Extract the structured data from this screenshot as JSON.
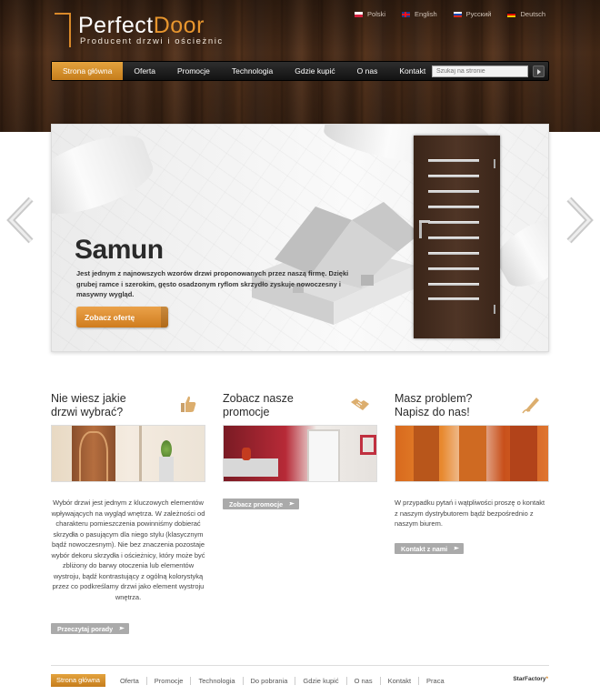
{
  "brand": {
    "name_part1": "Perfect",
    "name_part2": "Door",
    "tagline": "Producent drzwi i ościeżnic"
  },
  "languages": [
    {
      "label": "Polski",
      "flag": "pl-flag-icon"
    },
    {
      "label": "English",
      "flag": "uk-flag-icon"
    },
    {
      "label": "Русский",
      "flag": "ru-flag-icon"
    },
    {
      "label": "Deutsch",
      "flag": "de-flag-icon"
    }
  ],
  "nav": {
    "items": [
      "Strona główna",
      "Oferta",
      "Promocje",
      "Technologia",
      "Gdzie kupić",
      "O nas",
      "Kontakt"
    ],
    "active_index": 0,
    "search_placeholder": "Szukaj na stronie"
  },
  "slider": {
    "title": "Samun",
    "text": "Jest jednym z najnowszych wzorów drzwi proponowanych przez naszą firmę. Dzięki grubej ramce i szerokim, gęsto osadzonym ryflom skrzydło zyskuje nowoczesny i masywny wygląd.",
    "button": "Zobacz ofertę"
  },
  "features": [
    {
      "title_line1": "Nie wiesz jakie",
      "title_line2": "drzwi wybrać?",
      "icon": "thumbs-up-icon",
      "text": "Wybór drzwi jest jednym z kluczowych elementów wpływających na wygląd wnętrza. W zależności od charakteru pomieszczenia powinniśmy dobierać skrzydła o pasującym dla niego stylu (klasycznym bądź nowoczesnym). Nie bez znaczenia pozostaje wybór dekoru skrzydła i ościeżnicy, który może być zbliżony do barwy otoczenia lub elementów wystroju, bądź kontrastujący z ogólną kolorystyką przez co podkreślamy drzwi jako element wystroju wnętrza.",
      "button": "Przeczytaj porady"
    },
    {
      "title_line1": "Zobacz nasze",
      "title_line2": "promocje",
      "icon": "handshake-icon",
      "text": "",
      "button": "Zobacz promocje"
    },
    {
      "title_line1": "Masz problem?",
      "title_line2": "Napisz do nas!",
      "icon": "pen-icon",
      "text": "W przypadku pytań i wątpliwości proszę o kontakt z naszym dystrybutorem bądź bezpośrednio z naszym biurem.",
      "button": "Kontakt z nami"
    }
  ],
  "footer": {
    "items": [
      "Strona główna",
      "Oferta",
      "Promocje",
      "Technologia",
      "Do pobrania",
      "Gdzie kupić",
      "O nas",
      "Kontakt",
      "Praca"
    ],
    "credit": "StarFactory"
  },
  "colors": {
    "accent": "#d9892a",
    "nav_bg": "#1b1b1b",
    "button_gray": "#aaaaaa"
  }
}
